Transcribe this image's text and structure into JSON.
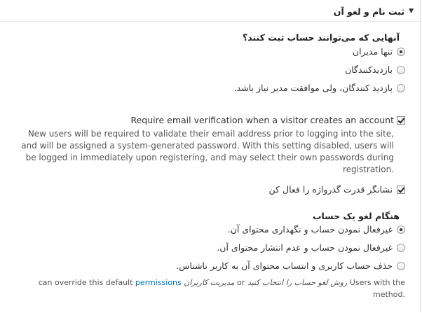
{
  "section": {
    "title": "ثبت نام و لغو آن"
  },
  "who_can_register": {
    "title": "آنهایی که می‌توانند حساب ثبت کنند؟",
    "options": [
      {
        "label": "تنها مدیران",
        "checked": true
      },
      {
        "label": "بازدیدکنندگان",
        "checked": false
      },
      {
        "label": "بازدید کنندگان، ولی موافقت مدیر نیاز باشد.",
        "checked": false
      }
    ]
  },
  "email_verification": {
    "label": "Require email verification when a visitor creates an account",
    "checked": true,
    "description": "New users will be required to validate their email address prior to logging into the site, and will be assigned a system-generated password. With this setting disabled, users will be logged in immediately upon registering, and may select their own passwords during registration."
  },
  "password_strength": {
    "label": "نشانگر قدرت گذرواژه را فعال کن",
    "checked": true
  },
  "cancel_account": {
    "title": "هنگام لغو یک حساب",
    "options": [
      {
        "label": "غیرفعال نمودن حساب و نگهداری محتوای آن.",
        "checked": true
      },
      {
        "label": "غیرفعال نمودن حساب و عدم انتشار محتوای آن.",
        "checked": false
      },
      {
        "label": "حذف حساب کاربری و انتساب محتوای آن به کاربر ناشناس.",
        "checked": false
      }
    ],
    "note": {
      "part1": "Users with the",
      "perm1": "روش لغو حساب را انتخاب کنید",
      "part2": "or",
      "perm2": "مدیریت کاربران",
      "part3": "permissions can override this default",
      "link": "permissions",
      "part4": "can override this default method."
    }
  }
}
